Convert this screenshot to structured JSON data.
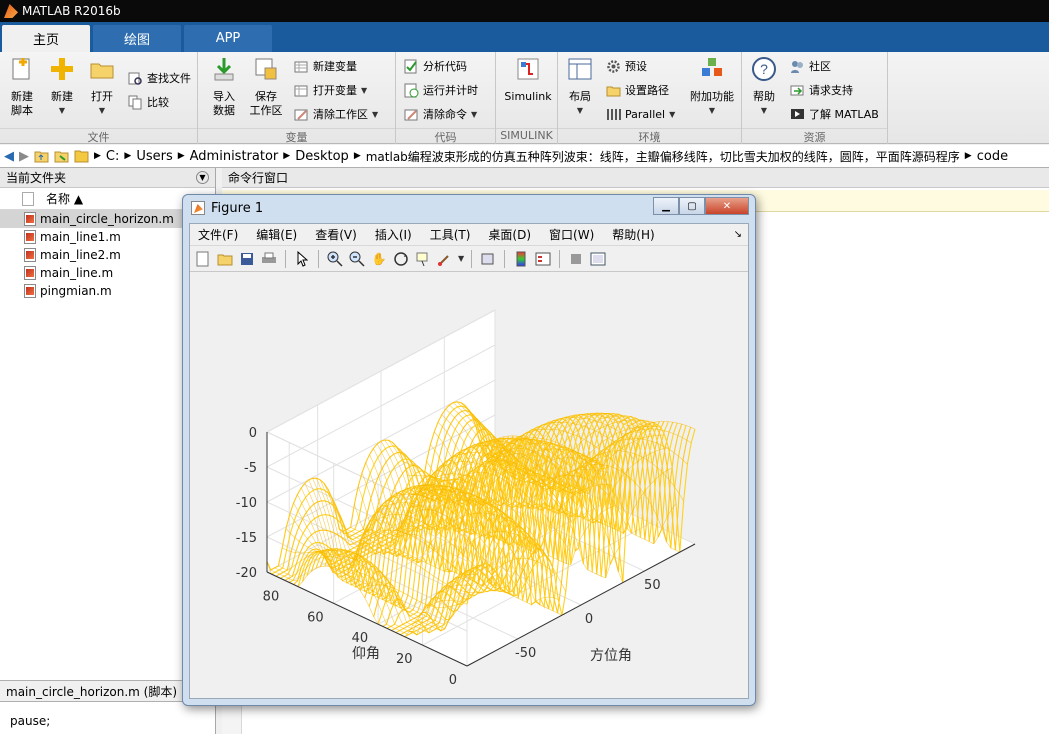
{
  "app": {
    "title": "MATLAB R2016b"
  },
  "tabs": [
    {
      "label": "主页"
    },
    {
      "label": "绘图"
    },
    {
      "label": "APP"
    }
  ],
  "ribbon": {
    "file": {
      "group_label": "文件",
      "new_script": "新建\n脚本",
      "new": "新建",
      "open": "打开",
      "find_files": "查找文件",
      "compare": "比较"
    },
    "variable": {
      "group_label": "变量",
      "import": "导入\n数据",
      "save_ws": "保存\n工作区",
      "new_var": "新建变量",
      "open_var": "打开变量",
      "clear_ws": "清除工作区"
    },
    "code": {
      "group_label": "代码",
      "analyze": "分析代码",
      "run_time": "运行并计时",
      "clear_cmd": "清除命令"
    },
    "simulink": {
      "group_label": "SIMULINK",
      "simulink": "Simulink"
    },
    "env": {
      "group_label": "环境",
      "layout": "布局",
      "prefs": "预设",
      "set_path": "设置路径",
      "parallel": "Parallel",
      "addons": "附加功能"
    },
    "resources": {
      "group_label": "资源",
      "help": "帮助",
      "community": "社区",
      "support": "请求支持",
      "learn": "了解 MATLAB"
    }
  },
  "address": {
    "crumbs": [
      "C:",
      "Users",
      "Administrator",
      "Desktop",
      "matlab编程波束形成的仿真五种阵列波束：线阵，主瓣偏移线阵，切比雪夫加权的线阵，圆阵，平面阵源码程序",
      "code"
    ]
  },
  "current_folder": {
    "title": "当前文件夹",
    "col_name": "名称 ▲",
    "files": [
      "main_circle_horizon.m",
      "main_line1.m",
      "main_line2.m",
      "main_line.m",
      "pingmian.m"
    ]
  },
  "details": {
    "label": "main_circle_horizon.m  (脚本)",
    "code": "pause;"
  },
  "command_window": {
    "title": "命令行窗口"
  },
  "figure": {
    "title": "Figure 1",
    "menus": [
      "文件(F)",
      "编辑(E)",
      "查看(V)",
      "插入(I)",
      "工具(T)",
      "桌面(D)",
      "窗口(W)",
      "帮助(H)"
    ]
  },
  "chart_data": {
    "type": "surface",
    "title": "",
    "xlabel": "方位角",
    "ylabel": "仰角",
    "zlabel": "",
    "xlim": [
      -90,
      90
    ],
    "ylim": [
      0,
      90
    ],
    "zlim": [
      -20,
      0
    ],
    "xticks": [
      -50,
      0,
      50
    ],
    "yticks": [
      0,
      20,
      40,
      60,
      80
    ],
    "zticks": [
      0,
      -5,
      -10,
      -15,
      -20
    ],
    "color": "#ffd21e",
    "grid": true
  }
}
